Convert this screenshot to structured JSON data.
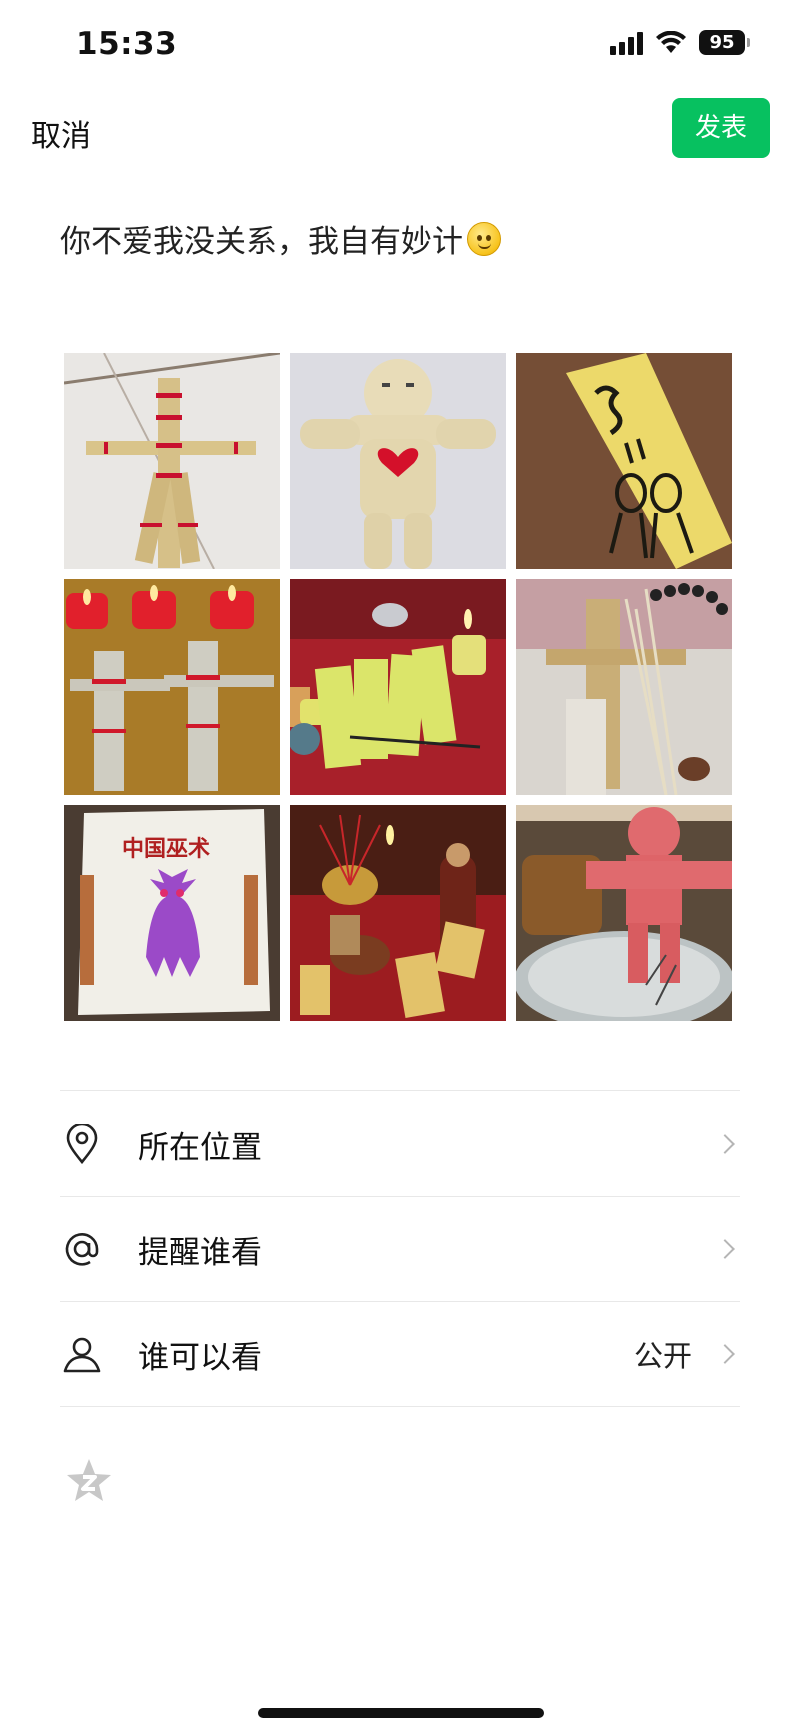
{
  "status": {
    "time": "15:33",
    "battery": "95"
  },
  "nav": {
    "cancel": "取消",
    "publish": "发表",
    "publish_color": "#07c160"
  },
  "post": {
    "text": "你不爱我没关系，我自有妙计"
  },
  "photos": [
    {
      "icon": "straw-doll-photo"
    },
    {
      "icon": "yarn-doll-photo"
    },
    {
      "icon": "talisman-paper-photo"
    },
    {
      "icon": "candles-straw-dolls-photo"
    },
    {
      "icon": "yellow-talismans-photo"
    },
    {
      "icon": "straw-doll-incense-photo"
    },
    {
      "icon": "book-cover-photo",
      "book_title": "中国巫术"
    },
    {
      "icon": "altar-photo"
    },
    {
      "icon": "paper-figure-photo"
    }
  ],
  "options": [
    {
      "label": "所在位置",
      "icon": "location-pin-icon"
    },
    {
      "label": "提醒谁看",
      "icon": "at-sign-icon"
    },
    {
      "label": "谁可以看",
      "icon": "person-icon",
      "value": "公开"
    }
  ]
}
